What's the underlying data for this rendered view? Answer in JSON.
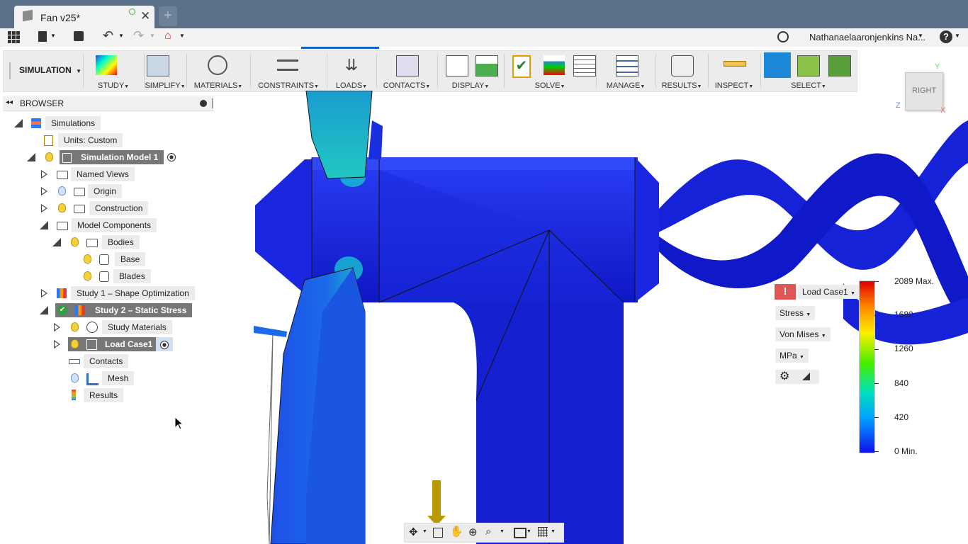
{
  "window": {
    "tab_title": "Fan v25*"
  },
  "quickbar": {
    "user": "Nathanaelaaronjenkins Na..."
  },
  "ribbon": {
    "workspace": "SIMULATION",
    "groups": [
      "STUDY",
      "SIMPLIFY",
      "MATERIALS",
      "CONSTRAINTS",
      "LOADS",
      "CONTACTS",
      "DISPLAY",
      "SOLVE",
      "MANAGE",
      "RESULTS",
      "INSPECT",
      "SELECT"
    ]
  },
  "browser": {
    "title": "BROWSER",
    "items": [
      {
        "label": "Simulations"
      },
      {
        "label": "Units: Custom"
      },
      {
        "label": "Simulation Model 1"
      },
      {
        "label": "Named Views"
      },
      {
        "label": "Origin"
      },
      {
        "label": "Construction"
      },
      {
        "label": "Model Components"
      },
      {
        "label": "Bodies"
      },
      {
        "label": "Base"
      },
      {
        "label": "Blades"
      },
      {
        "label": "Study 1 – Shape Optimization"
      },
      {
        "label": "Study 2 – Static Stress"
      },
      {
        "label": "Study Materials"
      },
      {
        "label": "Load Case1"
      },
      {
        "label": "Contacts"
      },
      {
        "label": "Mesh"
      },
      {
        "label": "Results"
      }
    ]
  },
  "viewcube": {
    "face": "RIGHT",
    "x": "X",
    "y": "Y",
    "z": "Z"
  },
  "results_panel": {
    "load_case": "Load Case1",
    "result_type": "Stress",
    "component": "Von Mises",
    "units": "MPa",
    "scale_labels": [
      "2089 Max.",
      "1680",
      "1260",
      "840",
      "420",
      "0 Min."
    ]
  },
  "colors": {
    "accent": "#1e88d8",
    "mesh_blue": "#1a1ad8",
    "title_bar": "#5a7088"
  }
}
